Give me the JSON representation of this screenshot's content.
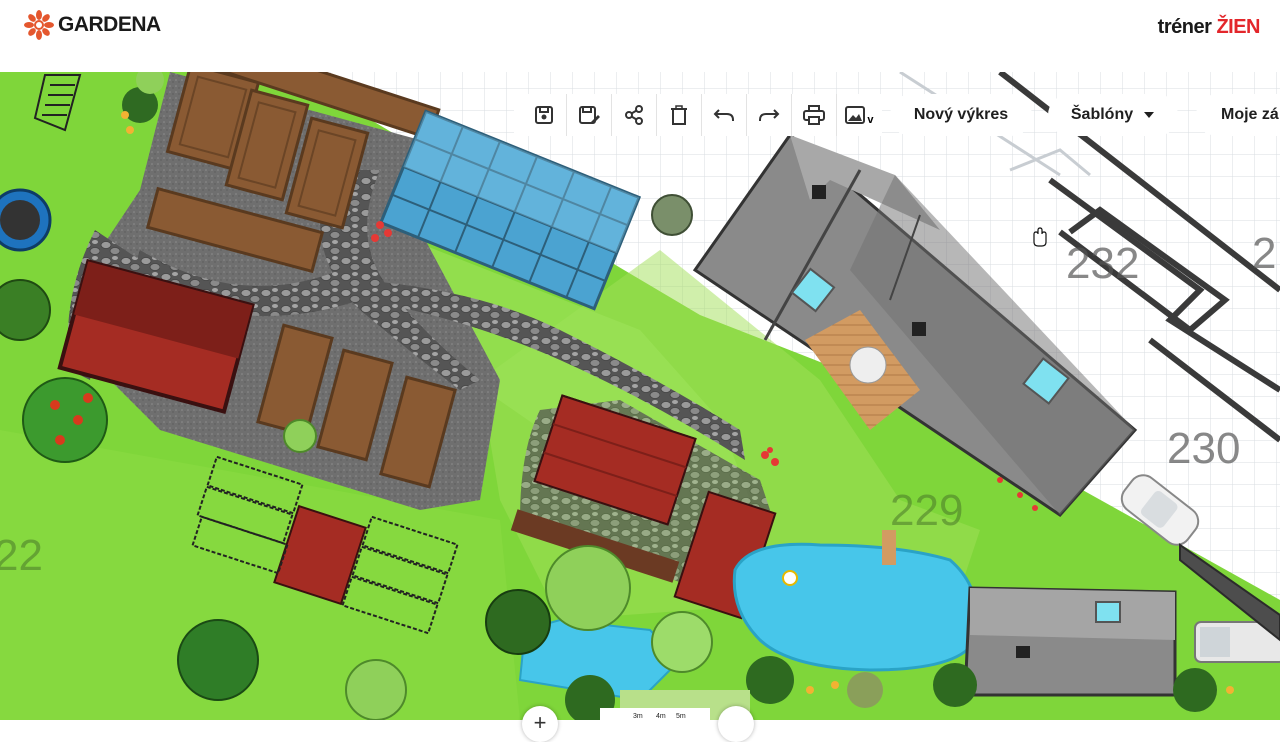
{
  "header": {
    "brand": "GARDENA",
    "trainer_prefix": "tréner",
    "trainer_accent": "ŽIEN"
  },
  "toolbar": {
    "icons": [
      "save-icon",
      "save-as-icon",
      "share-icon",
      "delete-icon",
      "undo-icon",
      "redo-icon",
      "print-icon",
      "image-export-icon"
    ],
    "image_caret": "v"
  },
  "buttons": {
    "new_drawing": "Nový výkres",
    "templates": "Šablóny",
    "my_drawings": "Moje zá"
  },
  "map": {
    "lot_numbers": [
      "232",
      "230",
      "229",
      "22"
    ],
    "scale_labels": [
      "3m",
      "4m",
      "5m"
    ],
    "zoom_in": "+"
  },
  "colors": {
    "grass": "#7fd63a",
    "grass_light": "#a8e35a",
    "roof": "#8a8a8a",
    "shed_red": "#a52c23",
    "water": "#47c6ea",
    "greenhouse": "#4ba3d1",
    "brand_red": "#e3262b"
  }
}
